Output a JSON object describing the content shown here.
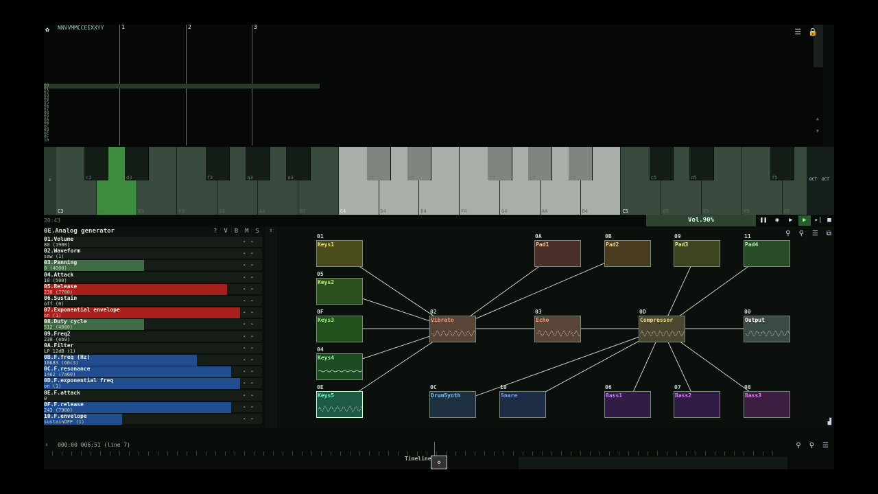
{
  "pattern": {
    "header": "NNVVMMCCEEXXYY",
    "beats": [
      "1",
      "2",
      "3"
    ],
    "rows": [
      "00",
      "01",
      "02",
      "03",
      "04",
      "05",
      "06",
      "07",
      "08",
      "09",
      "0A",
      "0B",
      "0C",
      "0D",
      "0E",
      "0F",
      "10"
    ],
    "first_cell": "00"
  },
  "piano": {
    "white_labels": [
      "C3",
      "D3",
      "E3",
      "F3",
      "G3",
      "A3",
      "B3",
      "C4",
      "D4",
      "E4",
      "F4",
      "G4",
      "A4",
      "B4",
      "C5",
      "D5",
      "E5",
      "F5",
      "G5"
    ],
    "black_labels": [
      "c3",
      "d3",
      "f3",
      "g3",
      "a3",
      "c4",
      "d4",
      "f4",
      "g4",
      "a4",
      "c5",
      "d5",
      "f5"
    ],
    "right_labels": [
      "OCT",
      "OCT"
    ]
  },
  "transport": {
    "time": "20:43",
    "volume": "Vol.90%"
  },
  "props": {
    "title": "0E.Analog generator",
    "tools": [
      "?",
      "V",
      "B",
      "M",
      "S"
    ],
    "rows": [
      {
        "name": "01.Volume",
        "value": "80 (1900)",
        "fill": 0.0,
        "color": "#2a3f2e"
      },
      {
        "name": "02.Waveform",
        "value": "saw (1)",
        "fill": 0.0,
        "color": "#2a3f2e"
      },
      {
        "name": "03.Panning",
        "value": "0 (4000)",
        "fill": 0.46,
        "color": "#3f6a44"
      },
      {
        "name": "04.Attack",
        "value": "10 (500)",
        "fill": 0.0,
        "color": "#6a1c1c"
      },
      {
        "name": "05.Release",
        "value": "230 (7700)",
        "fill": 0.84,
        "color": "#a8201c"
      },
      {
        "name": "06.Sustain",
        "value": "off (0)",
        "fill": 0.0,
        "color": "#2a3f2e"
      },
      {
        "name": "07.Exponential envelope",
        "value": "on (1)",
        "fill": 0.9,
        "color": "#a8201c"
      },
      {
        "name": "08.Duty cycle",
        "value": "512 (4000)",
        "fill": 0.46,
        "color": "#3f6a44"
      },
      {
        "name": "09.Freq2",
        "value": "230 (eb9)",
        "fill": 0.0,
        "color": "#2a3f2e"
      },
      {
        "name": "0A.Filter",
        "value": "LP 12dB (1)",
        "fill": 0.0,
        "color": "#1c2a48"
      },
      {
        "name": "0B.F.freq (Hz)",
        "value": "10683 (60c3)",
        "fill": 0.7,
        "color": "#204c90"
      },
      {
        "name": "0C.F.resonance",
        "value": "1462 (7a60)",
        "fill": 0.86,
        "color": "#204c90"
      },
      {
        "name": "0D.F.exponential freq",
        "value": "on (1)",
        "fill": 0.9,
        "color": "#204c90"
      },
      {
        "name": "0E.F.attack",
        "value": "0",
        "fill": 0.0,
        "color": "#1c2a48"
      },
      {
        "name": "0F.F.release",
        "value": "243 (7900)",
        "fill": 0.86,
        "color": "#204c90"
      },
      {
        "name": "10.F.envelope",
        "value": "sustainOFF (1)",
        "fill": 0.36,
        "color": "#204c90"
      }
    ]
  },
  "graph": {
    "nodes": [
      {
        "id": "01",
        "name": "Keys1",
        "bg": "#4a4c1c",
        "fg": "#f0e070"
      },
      {
        "id": "05",
        "name": "Keys2",
        "bg": "#2c501c",
        "fg": "#c8f080"
      },
      {
        "id": "0F",
        "name": "Keys3",
        "bg": "#20501c",
        "fg": "#a8f080"
      },
      {
        "id": "04",
        "name": "Keys4",
        "bg": "#1c4c24",
        "fg": "#a0f0a0"
      },
      {
        "id": "0E",
        "name": "Keys5",
        "bg": "#1c5a44",
        "fg": "#80f0d0"
      },
      {
        "id": "02",
        "name": "Vibrato",
        "bg": "#5a4438",
        "fg": "#f0a080"
      },
      {
        "id": "0A",
        "name": "Pad1",
        "bg": "#4a3028",
        "fg": "#f0c0a0"
      },
      {
        "id": "0B",
        "name": "Pad2",
        "bg": "#4a3c20",
        "fg": "#f0d090"
      },
      {
        "id": "03",
        "name": "Echo",
        "bg": "#5a4438",
        "fg": "#f0a080"
      },
      {
        "id": "09",
        "name": "Pad3",
        "bg": "#3c4420",
        "fg": "#e0f090"
      },
      {
        "id": "0D",
        "name": "Compressor",
        "bg": "#4c4830",
        "fg": "#f0e090"
      },
      {
        "id": "11",
        "name": "Pad4",
        "bg": "#284c28",
        "fg": "#b0f0b0"
      },
      {
        "id": "00",
        "name": "Output",
        "bg": "#3c4a44",
        "fg": "#ffffff"
      },
      {
        "id": "0C",
        "name": "DrumSynth",
        "bg": "#1c3040",
        "fg": "#80c0f0"
      },
      {
        "id": "10",
        "name": "Snare",
        "bg": "#1c2c44",
        "fg": "#80a0f0"
      },
      {
        "id": "06",
        "name": "Bass1",
        "bg": "#301c44",
        "fg": "#c080f0"
      },
      {
        "id": "07",
        "name": "Bass2",
        "bg": "#301c44",
        "fg": "#d080f0"
      },
      {
        "id": "08",
        "name": "Bass3",
        "bg": "#3c1c40",
        "fg": "#e080f0"
      }
    ]
  },
  "timeline": {
    "position": "000:00 006:51 (line 7)",
    "label": "Timeline"
  },
  "icons": {
    "menu": "menu-icon",
    "lock": "lock-icon",
    "play": "play-icon",
    "stop": "stop-icon"
  }
}
